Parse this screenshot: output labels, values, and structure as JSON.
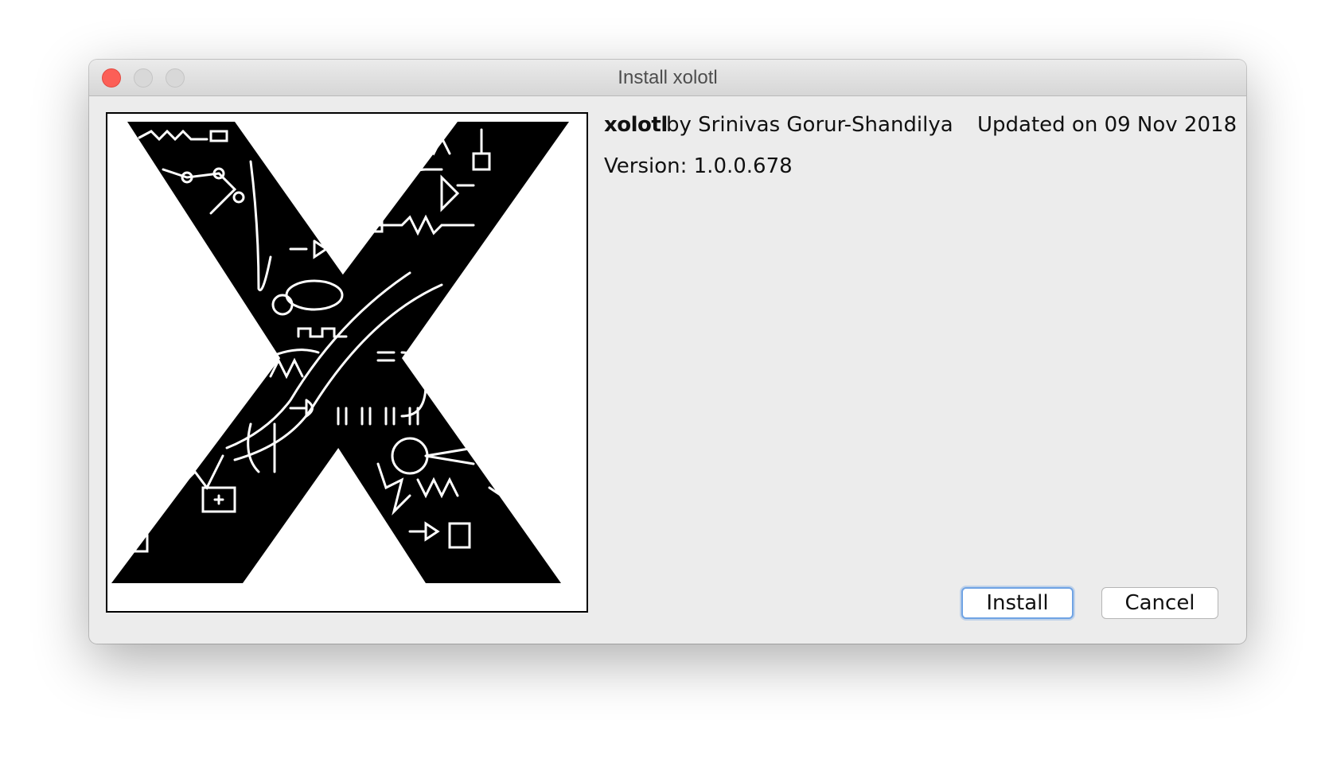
{
  "window": {
    "title": "Install xolotl"
  },
  "toolbox": {
    "name": "xolotl",
    "author": "by Srinivas Gorur-Shandilya",
    "updated": "Updated on 09 Nov 2018",
    "version": "Version: 1.0.0.678",
    "logo": "xolotl-x-logo"
  },
  "buttons": {
    "install": "Install",
    "cancel": "Cancel"
  },
  "colors": {
    "close_button": "#fc5f57",
    "focus_ring": "#6fa3e4"
  }
}
